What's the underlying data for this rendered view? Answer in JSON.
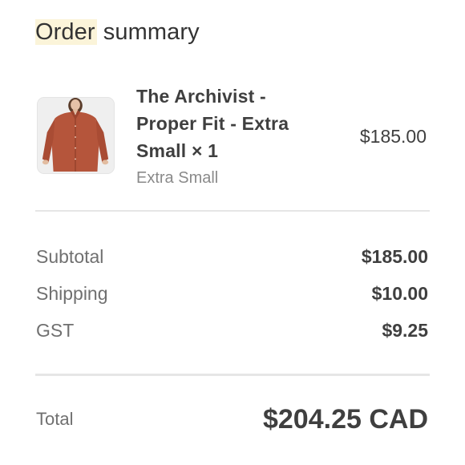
{
  "summary": {
    "heading_highlight": "Order",
    "heading_rest": " summary"
  },
  "item": {
    "title": "The Archivist - Proper Fit - Extra Small × 1",
    "variant": "Extra Small",
    "price": "$185.00",
    "image_icon": "product-thumbnail-shirt"
  },
  "totals": {
    "rows": [
      {
        "label": "Subtotal",
        "value": "$185.00"
      },
      {
        "label": "Shipping",
        "value": "$10.00"
      },
      {
        "label": "GST",
        "value": "$9.25"
      }
    ],
    "total_label": "Total",
    "total_value": "$204.25 CAD"
  },
  "colors": {
    "highlight": "#fbf4d9",
    "shirt": "#b5553b"
  }
}
